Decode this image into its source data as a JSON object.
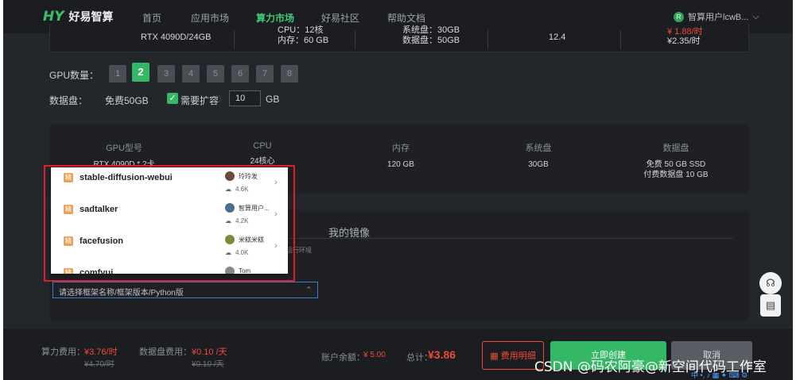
{
  "nav": {
    "logo_text": "好易智算",
    "items": [
      "首页",
      "应用市场",
      "算力市场",
      "好易社区",
      "帮助文档"
    ],
    "active_index": 2,
    "user_name": "智算用户lcwB...",
    "user_avatar_letter": "R"
  },
  "spec_row": {
    "gpu": "RTX 4090D/24GB",
    "cpu": "CPU：12核",
    "mem": "内存：60 GB",
    "sys_disk": "系统盘：30GB",
    "data_disk": "数据盘：50GB",
    "cuda": "12.4",
    "price_now": "¥ 1.88/时",
    "price_orig": "¥2.35/时"
  },
  "gpu_count": {
    "label": "GPU数量：",
    "options": [
      "1",
      "2",
      "3",
      "4",
      "5",
      "6",
      "7",
      "8"
    ],
    "selected": "2"
  },
  "data_disk": {
    "label": "数据盘：",
    "free": "免费50GB",
    "expand_label": "需要扩容",
    "expand_checked": true,
    "value": "10",
    "unit": "GB"
  },
  "summary": {
    "headers": [
      "GPU型号",
      "CPU",
      "内存",
      "系统盘",
      "数据盘"
    ],
    "values": [
      "RTX 4090D * 2卡",
      "24核心",
      "120 GB",
      "30GB",
      "免费 50 GB SSD"
    ],
    "extra": "付费数据盘 10 GB"
  },
  "image_section": {
    "tab_label": "我的镜像",
    "hint": "运行环境",
    "select_placeholder": "请选择框架名称/框架版本/Python版"
  },
  "popup_items": [
    {
      "tag": "精",
      "name": "stable-diffusion-webui",
      "author": "玲玲发",
      "stars": "4.6K"
    },
    {
      "tag": "精",
      "name": "sadtalker",
      "author": "智算用户...",
      "stars": "4.2K"
    },
    {
      "tag": "精",
      "name": "facefusion",
      "author": "米糕米糕",
      "stars": "4.0K"
    },
    {
      "tag": "精",
      "name": "comfyui",
      "author": "Tom",
      "stars": ""
    }
  ],
  "bottom": {
    "compute_label": "算力费用：",
    "compute_val": "¥3.76/时",
    "compute_orig": "¥4.70/时",
    "disk_label": "数据盘费用：",
    "disk_val": "¥0.10 /天",
    "disk_orig": "¥0.10 /天",
    "balance_label": "账户余额：",
    "balance_val": "¥ 5.00",
    "total_label": "总计：",
    "total_val": "¥3.86",
    "detail_btn": "费用明细",
    "create_btn": "立即创建",
    "cancel_btn": "取消"
  },
  "watermark": "CSDN @码农阿豪@新空间代码工作室",
  "colors": {
    "accent": "#34b865",
    "price": "#f04b3a",
    "highlight": "#e11d2a"
  }
}
